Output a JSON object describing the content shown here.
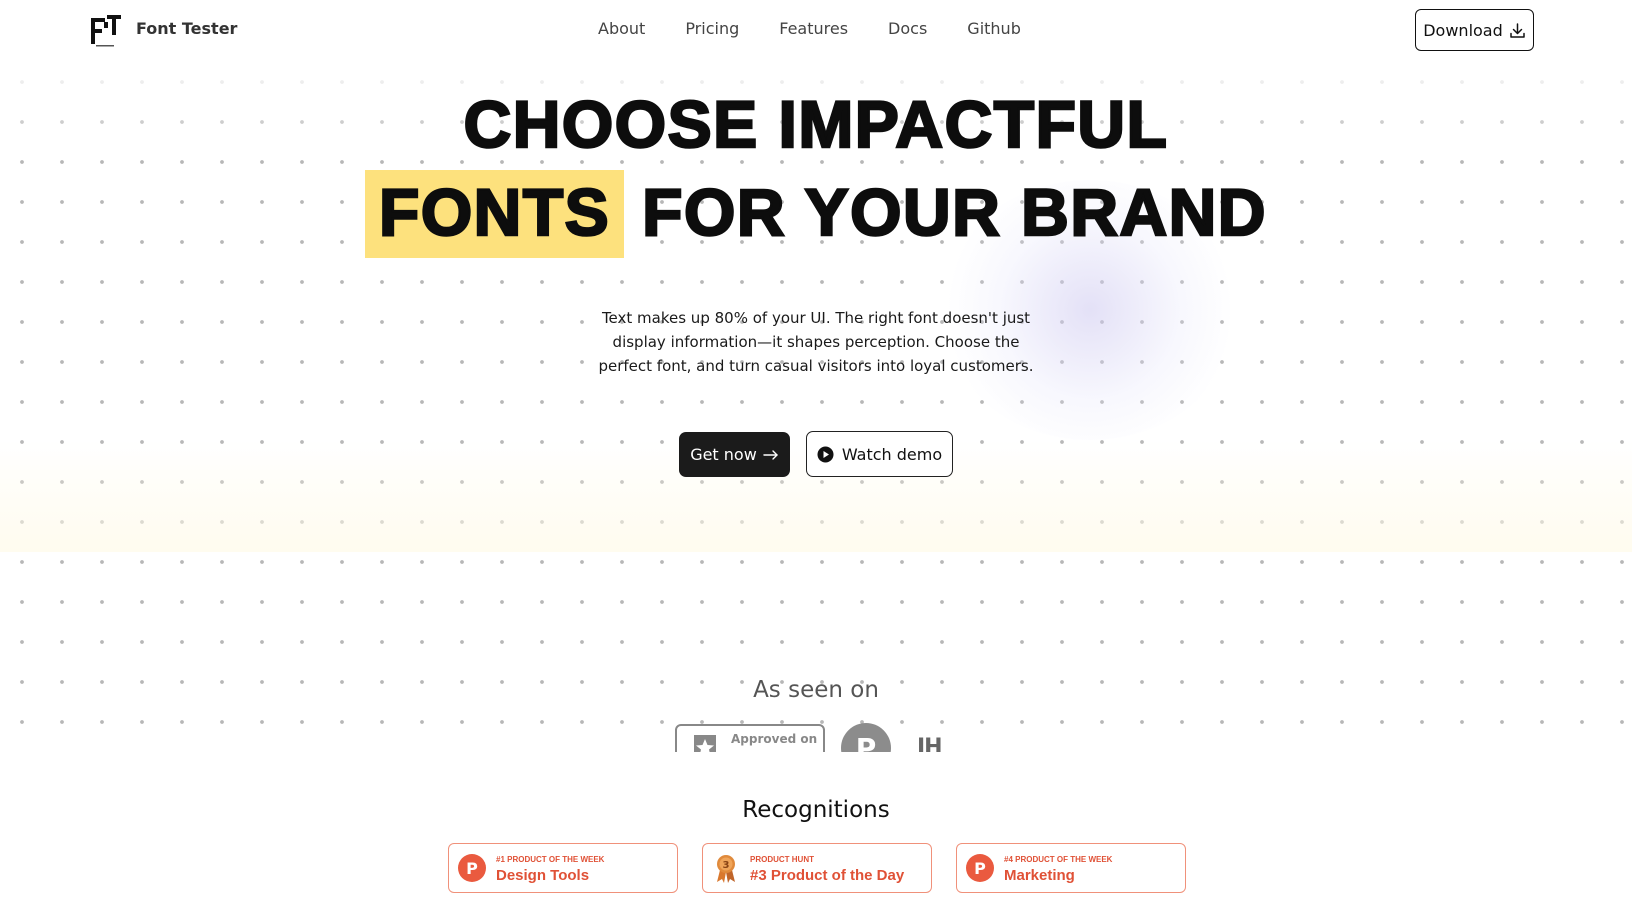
{
  "brand": {
    "name": "Font Tester",
    "logo_icon": "ft-logo-icon"
  },
  "nav": {
    "items": [
      "About",
      "Pricing",
      "Features",
      "Docs",
      "Github"
    ],
    "download_label": "Download"
  },
  "hero": {
    "title_line1": "CHOOSE IMPACTFUL",
    "title_highlight": "FONTS",
    "title_line2_rest": "FOR YOUR BRAND",
    "highlight_color": "#fde17d",
    "subtitle": "Text makes up 80% of your UI. The right font doesn't just display information—it shapes perception. Choose the perfect font, and turn casual visitors into loyal customers.",
    "primary_cta": "Get now",
    "secondary_cta": "Watch demo"
  },
  "seen_on": {
    "title": "As seen on",
    "badge_text": "Approved on",
    "logos": [
      "approved-badge-icon",
      "producthunt-icon",
      "indiehackers-icon"
    ],
    "ph_letter": "P",
    "ih_text": "IH"
  },
  "recognitions": {
    "title": "Recognitions",
    "accent_color": "#e05136",
    "cards": [
      {
        "small": "#1 PRODUCT OF THE WEEK",
        "big": "Design Tools",
        "icon": "producthunt-icon",
        "icon_letter": "P"
      },
      {
        "small": "PRODUCT HUNT",
        "big": "#3 Product of the Day",
        "icon": "medal-icon",
        "icon_letter": "3"
      },
      {
        "small": "#4 PRODUCT OF THE WEEK",
        "big": "Marketing",
        "icon": "producthunt-icon",
        "icon_letter": "P"
      }
    ]
  }
}
